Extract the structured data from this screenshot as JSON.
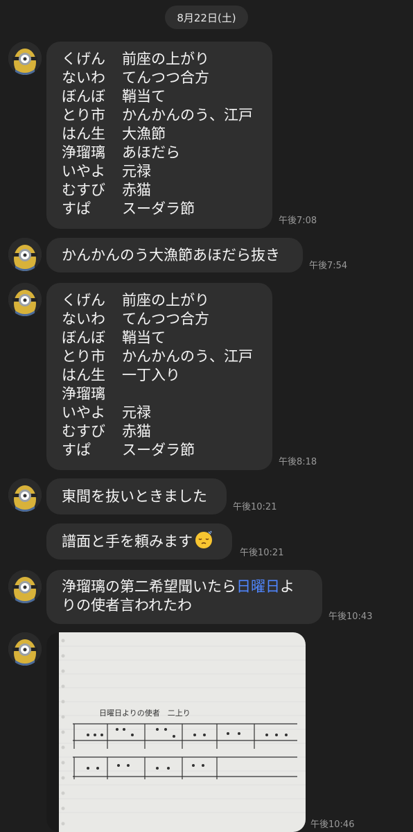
{
  "date_label": "8月22日(土)",
  "messages": [
    {
      "rows": [
        [
          "くげん",
          "前座の上がり"
        ],
        [
          "ないわ",
          "てんつつ合方"
        ],
        [
          "ぼんぼ",
          "鞘当て"
        ],
        [
          "とり市",
          "かんかんのう、江戸"
        ],
        [
          "はん生",
          "大漁節"
        ],
        [
          "浄瑠璃",
          "あほだら"
        ],
        [
          "いやよ",
          "元禄"
        ],
        [
          "むすび",
          "赤猫"
        ],
        [
          "すぱ",
          "スーダラ節"
        ]
      ],
      "time": "午後7:08"
    },
    {
      "text": "かんかんのう大漁節あほだら抜き",
      "time": "午後7:54"
    },
    {
      "rows": [
        [
          "くげん",
          "前座の上がり"
        ],
        [
          "ないわ",
          "てんつつ合方"
        ],
        [
          "ぼんぼ",
          "鞘当て"
        ],
        [
          "とり市",
          "かんかんのう、江戸"
        ],
        [
          "はん生",
          "一丁入り"
        ],
        [
          "浄瑠璃",
          ""
        ],
        [
          "いやよ",
          "元禄"
        ],
        [
          "むすび",
          "赤猫"
        ],
        [
          "すぱ",
          "スーダラ節"
        ]
      ],
      "time": "午後8:18"
    },
    {
      "text": "東間を抜いときました",
      "time": "午後10:21"
    },
    {
      "text": "譜面と手を頼みます",
      "emoji": "sleepy-face-icon",
      "time": "午後10:21"
    },
    {
      "line1_prefix": "浄瑠璃の第二希望聞いたら",
      "line1_link": "日曜日",
      "line1_suffix": "よ",
      "line2": "りの使者言われたわ",
      "time": "午後10:43"
    },
    {
      "photo": {
        "title_text": "日曜日よりの使者　二上り"
      },
      "time": "午後10:46"
    }
  ],
  "colors": {
    "background": "#1e1e1e",
    "bubble": "#2f2f2f",
    "link": "#4f86ff",
    "time": "#9a9a9a"
  }
}
